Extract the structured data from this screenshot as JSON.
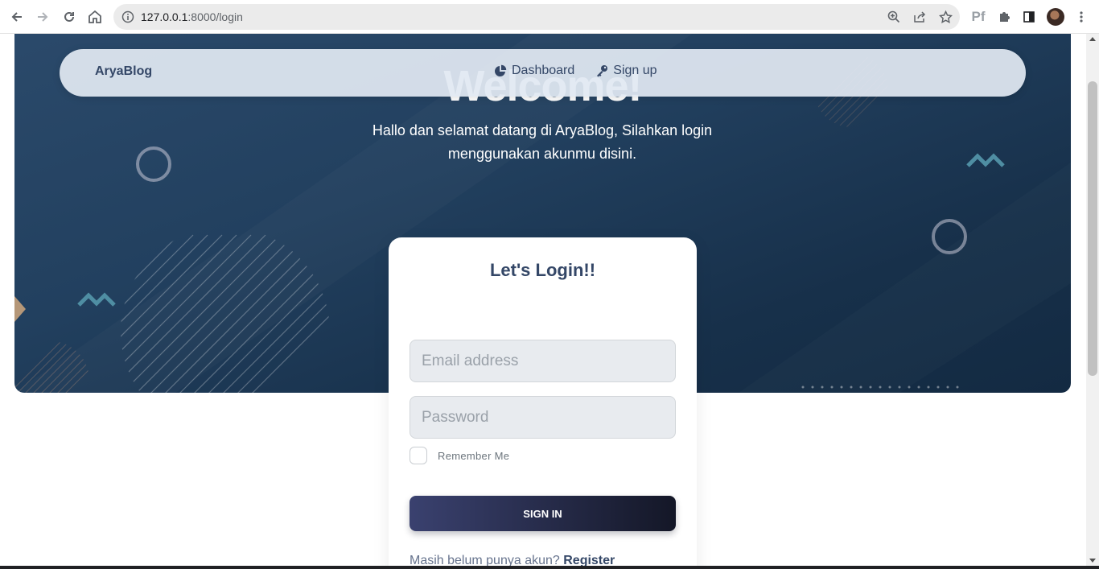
{
  "browser": {
    "url_host": "127.0.0.1",
    "url_path": ":8000/login",
    "icons": [
      "back-arrow-icon",
      "forward-arrow-icon",
      "reload-icon",
      "home-icon",
      "site-info-icon",
      "zoom-icon",
      "share-icon",
      "bookmark-star-icon",
      "pf-extension-icon",
      "puzzle-extensions-icon",
      "side-panel-icon",
      "profile-avatar",
      "more-menu-icon"
    ],
    "pf_label": "Pf"
  },
  "navbar": {
    "brand": "AryaBlog",
    "links": [
      {
        "label": "Dashboard",
        "icon": "pie-chart-icon"
      },
      {
        "label": "Sign up",
        "icon": "key-icon"
      }
    ]
  },
  "hero": {
    "title": "Welcome!",
    "subtitle": "Hallo dan selamat datang di AryaBlog, Silahkan login menggunakan akunmu disini."
  },
  "login": {
    "title": "Let's Login!!",
    "email_placeholder": "Email address",
    "password_placeholder": "Password",
    "remember_label": "Remember Me",
    "submit_label": "SIGN IN",
    "register_prompt": "Masih belum punya akun?",
    "register_link": "Register"
  },
  "colors": {
    "hero_bg": "#22405f",
    "primary_text": "#344767",
    "button_gradient_start": "#3a416f",
    "button_gradient_end": "#141727",
    "accent_zigzag": "#4f8ea3"
  }
}
